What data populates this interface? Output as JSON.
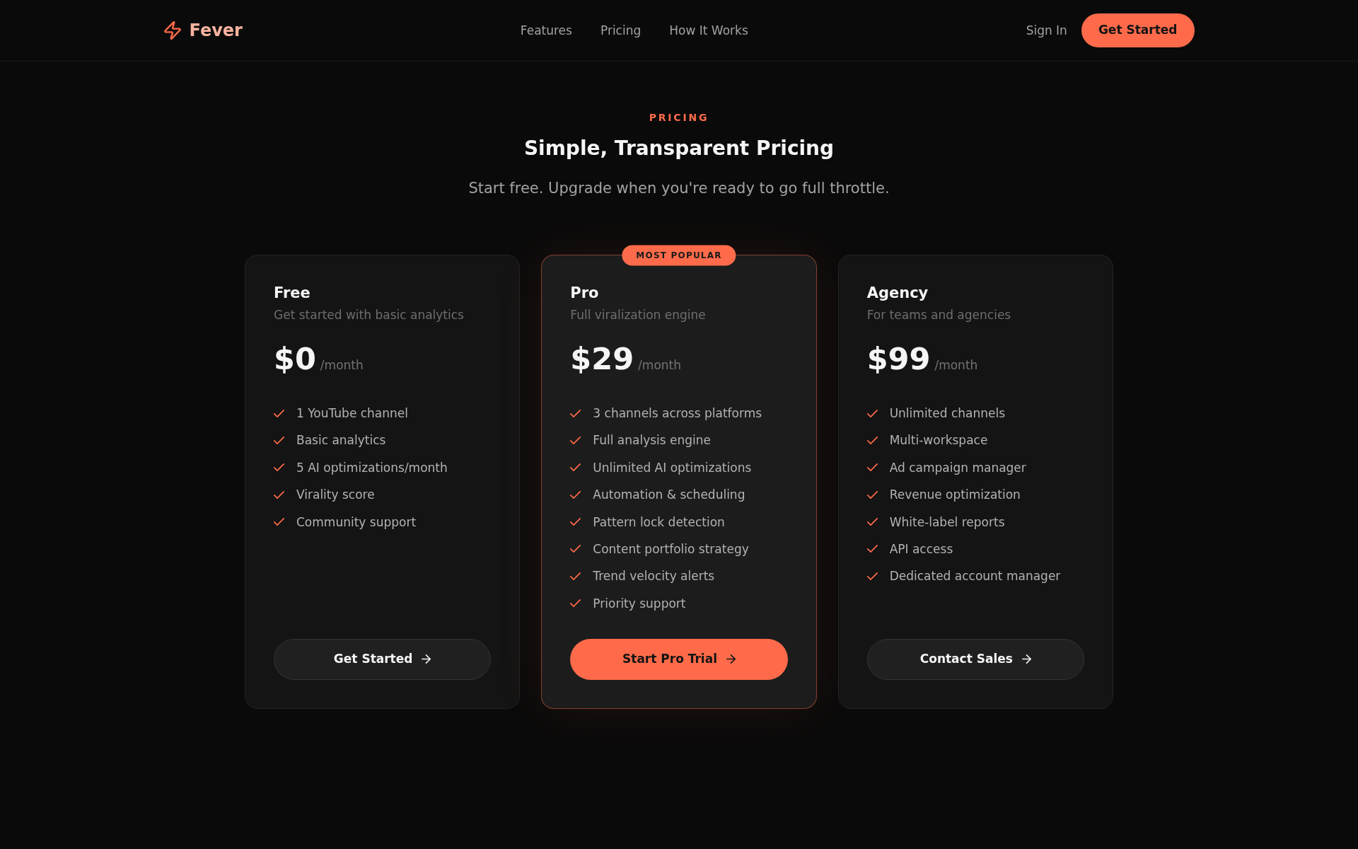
{
  "nav": {
    "brand": "Fever",
    "links": [
      {
        "label": "Features"
      },
      {
        "label": "Pricing"
      },
      {
        "label": "How It Works"
      }
    ],
    "sign_in": "Sign In",
    "cta": "Get Started"
  },
  "hero": {
    "eyebrow": "PRICING",
    "title": "Simple, Transparent Pricing",
    "subtitle": "Start free. Upgrade when you're ready to go full throttle."
  },
  "plans": [
    {
      "name": "Free",
      "description": "Get started with basic analytics",
      "price": "$0",
      "period": "/month",
      "featured": false,
      "features": [
        "1 YouTube channel",
        "Basic analytics",
        "5 AI optimizations/month",
        "Virality score",
        "Community support"
      ],
      "button": "Get Started"
    },
    {
      "name": "Pro",
      "badge": "MOST POPULAR",
      "description": "Full viralization engine",
      "price": "$29",
      "period": "/month",
      "featured": true,
      "features": [
        "3 channels across platforms",
        "Full analysis engine",
        "Unlimited AI optimizations",
        "Automation & scheduling",
        "Pattern lock detection",
        "Content portfolio strategy",
        "Trend velocity alerts",
        "Priority support"
      ],
      "button": "Start Pro Trial"
    },
    {
      "name": "Agency",
      "description": "For teams and agencies",
      "price": "$99",
      "period": "/month",
      "featured": false,
      "features": [
        "Unlimited channels",
        "Multi-workspace",
        "Ad campaign manager",
        "Revenue optimization",
        "White-label reports",
        "API access",
        "Dedicated account manager"
      ],
      "button": "Contact Sales"
    }
  ]
}
